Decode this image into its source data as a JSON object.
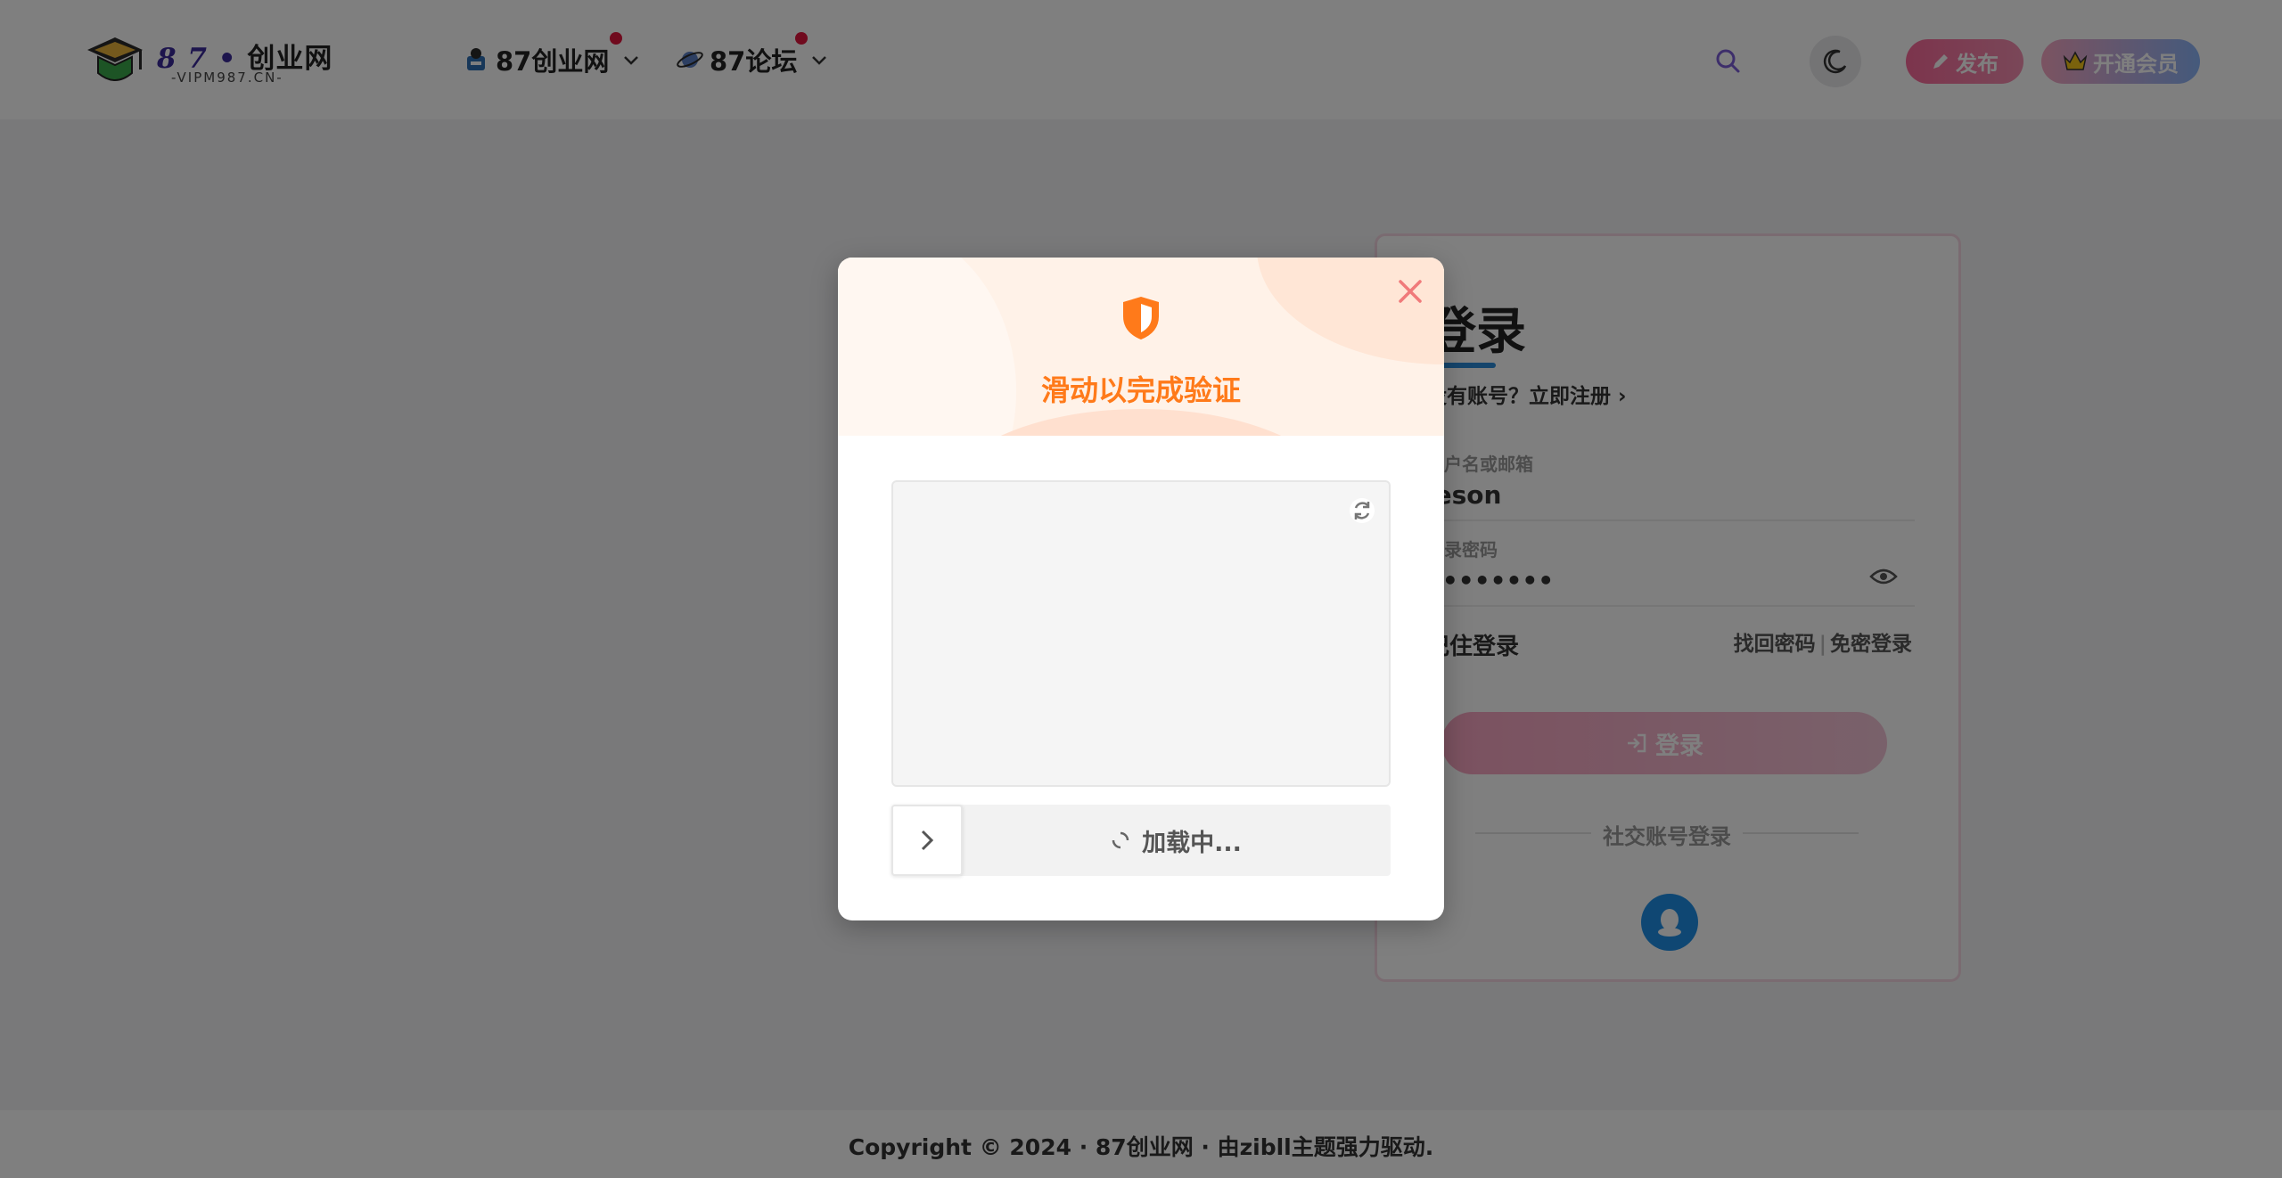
{
  "header": {
    "logo_numbers": "8 7",
    "logo_name": "创业网",
    "logo_sub": "-VIPM987.CN-",
    "nav": [
      {
        "label": "87创业网"
      },
      {
        "label": "87论坛"
      }
    ],
    "publish_label": "发布",
    "vip_label": "开通会员"
  },
  "login": {
    "title": "登录",
    "no_account": "没有账号？",
    "register_link": "立即注册",
    "username_label": "用户名或邮箱",
    "username_value": "jeson",
    "password_label": "登录密码",
    "password_value": "••••••••",
    "remember_label": "记住登录",
    "forgot_label": "找回密码",
    "nopass_label": "免密登录",
    "submit_label": "登录",
    "social_label": "社交账号登录"
  },
  "footer": {
    "text": "Copyright © 2024 · 87创业网 · 由zibll主题强力驱动."
  },
  "captcha": {
    "title": "滑动以完成验证",
    "status": "加载中..."
  },
  "colors": {
    "accent_orange": "#ff7a1a",
    "brand_pink": "#f9699a",
    "notify_red": "#e0143c",
    "qq_blue": "#1f8fe6"
  },
  "icons": [
    "graduation-cap-icon",
    "robot-icon",
    "planet-icon",
    "chevron-down-icon",
    "search-icon",
    "moon-icon",
    "pencil-icon",
    "crown-icon",
    "eye-icon",
    "sign-in-icon",
    "qq-icon",
    "shield-icon",
    "close-icon",
    "refresh-icon",
    "chevron-right-icon",
    "spinner-icon"
  ]
}
